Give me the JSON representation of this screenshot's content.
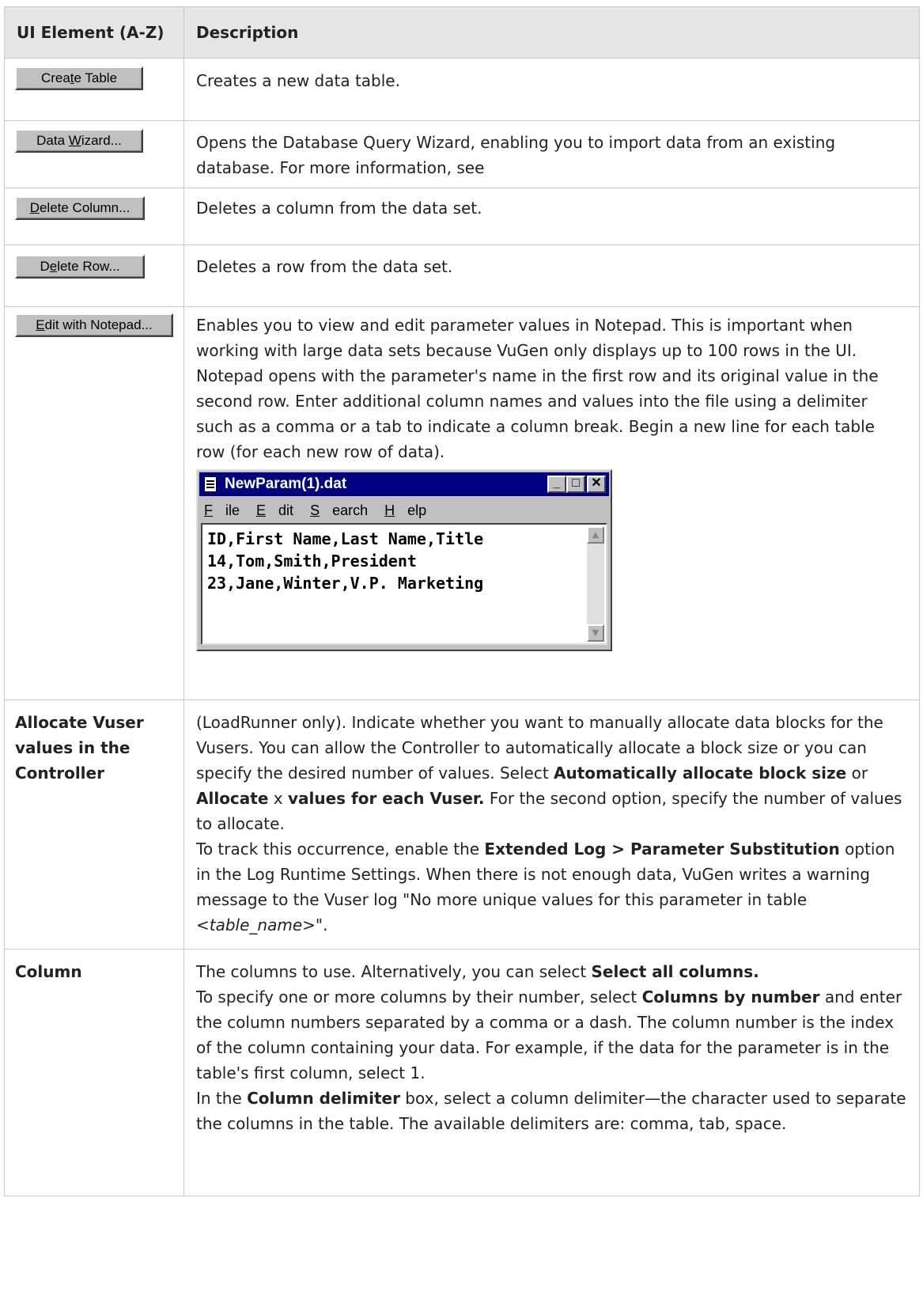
{
  "header": {
    "col1": "UI Element (A-Z)",
    "col2": "Description"
  },
  "buttons": {
    "create_table": {
      "pre": "Crea",
      "ul": "t",
      "post": "e Table",
      "desc": "Creates a new data table."
    },
    "data_wizard": {
      "pre": "Data ",
      "ul": "W",
      "post": "izard...",
      "desc": "Opens the Database Query Wizard, enabling you to import data from an existing database. For more information, see"
    },
    "delete_column": {
      "pre": "",
      "ul": "D",
      "post": "elete Column...",
      "desc": "Deletes a column from the data set."
    },
    "delete_row": {
      "pre": "D",
      "ul": "e",
      "post": "lete Row...",
      "desc": "Deletes a row from the data set."
    },
    "edit_notepad": {
      "pre": "",
      "ul": "E",
      "post": "dit with Notepad...",
      "desc1": "Enables you to view and edit parameter values in Notepad. This is important when working with large data sets because VuGen only displays up to 100 rows in the UI.",
      "desc2": "Notepad opens with the parameter's name in the first row and its original value in the second row. Enter additional column names and values into the file using a delimiter such as a comma or a tab to indicate a column break. Begin a new line for each table row (for each new row of data)."
    }
  },
  "notepad": {
    "title": "NewParam(1).dat",
    "menu": [
      "File",
      "Edit",
      "Search",
      "Help"
    ],
    "lines": [
      "ID,First Name,Last Name,Title",
      "14,Tom,Smith,President",
      "23,Jane,Winter,V.P. Marketing"
    ],
    "controls": {
      "min": "_",
      "max": "□",
      "close": "✕"
    }
  },
  "allocate": {
    "name": "Allocate Vuser values in the Controller",
    "p1a": "(LoadRunner only). Indicate whether you want to manually allocate data blocks for the Vusers. You can allow the Controller to automatically allocate a block size or you can specify the desired number of values. Select ",
    "p1b": "Automatically allocate block size",
    "p1c": " or ",
    "p1d": "Allocate",
    "p1e": " x ",
    "p1f": "values for each Vuser.",
    "p1g": " For the second option, specify the number of values to allocate.",
    "p2a": "To track this occurrence, enable the ",
    "p2b": "Extended Log > Parameter Substitution",
    "p2c": " option in the Log Runtime Settings. When there is not enough data, VuGen writes a warning message to the Vuser log \"No more unique values for this parameter in table <",
    "p2d": "table_name",
    "p2e": ">\"."
  },
  "column": {
    "name": "Column",
    "p1a": "The columns to use. Alternatively, you can select ",
    "p1b": "Select all columns.",
    "p2a": "To specify one or more columns by their number, select ",
    "p2b": "Columns by number",
    "p2c": " and enter the column numbers separated by a comma or a dash. The column number is the index of the column containing your data. For example, if the data for the parameter is in the table's first column, select 1.",
    "p3a": "In the ",
    "p3b": "Column delimiter",
    "p3c": " box, select a column delimiter—the character used to separate the columns in the table. The available delimiters are: comma, tab, space."
  }
}
